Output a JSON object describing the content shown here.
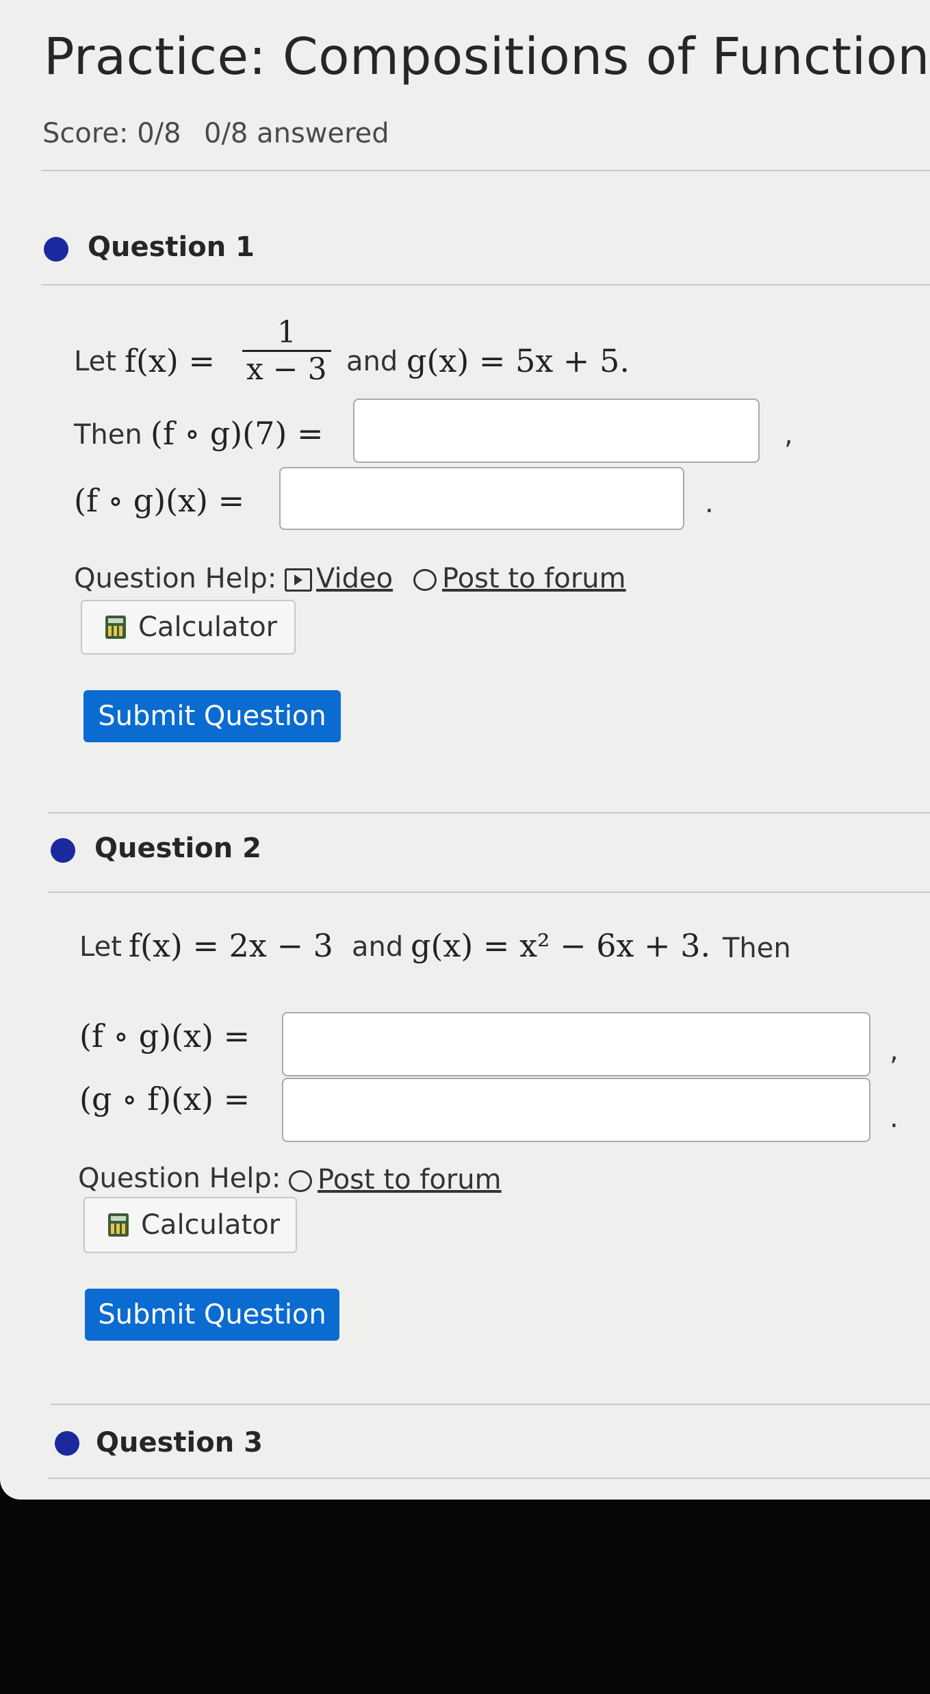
{
  "page": {
    "title": "Practice: Compositions of Functions",
    "score": "Score: 0/8",
    "answered": "0/8 answered"
  },
  "colors": {
    "accent_dot": "#1a2a9e",
    "submit_bg": "#0a6bd0",
    "background": "#efefed"
  },
  "q1": {
    "title": "Question 1",
    "let": "Let",
    "f_lhs": "f(x) =",
    "f_num": "1",
    "f_den": "x − 3",
    "and": "and",
    "g_def": "g(x) = 5x + 5.",
    "then": "Then",
    "expr1": "(f ∘ g)(7) =",
    "comma": ",",
    "expr2": "(f ∘ g)(x) =",
    "period": ".",
    "help_label": "Question Help:",
    "video": "Video",
    "forum": "Post to forum",
    "calculator": "Calculator",
    "submit": "Submit Question"
  },
  "q2": {
    "title": "Question 2",
    "let": "Let",
    "f_def": "f(x) = 2x − 3",
    "and": "and",
    "g_def": "g(x) = x² − 6x + 3.",
    "then": "Then",
    "expr1": "(f ∘ g)(x) =",
    "comma": ",",
    "expr2": "(g ∘ f)(x) =",
    "period": ".",
    "help_label": "Question Help:",
    "forum": "Post to forum",
    "calculator": "Calculator",
    "submit": "Submit Question"
  },
  "q3": {
    "title": "Question 3"
  },
  "icons": {
    "status_dot": "circle",
    "video": "video-play-icon",
    "forum": "speech-bubble-icon",
    "calculator": "calculator-icon"
  }
}
